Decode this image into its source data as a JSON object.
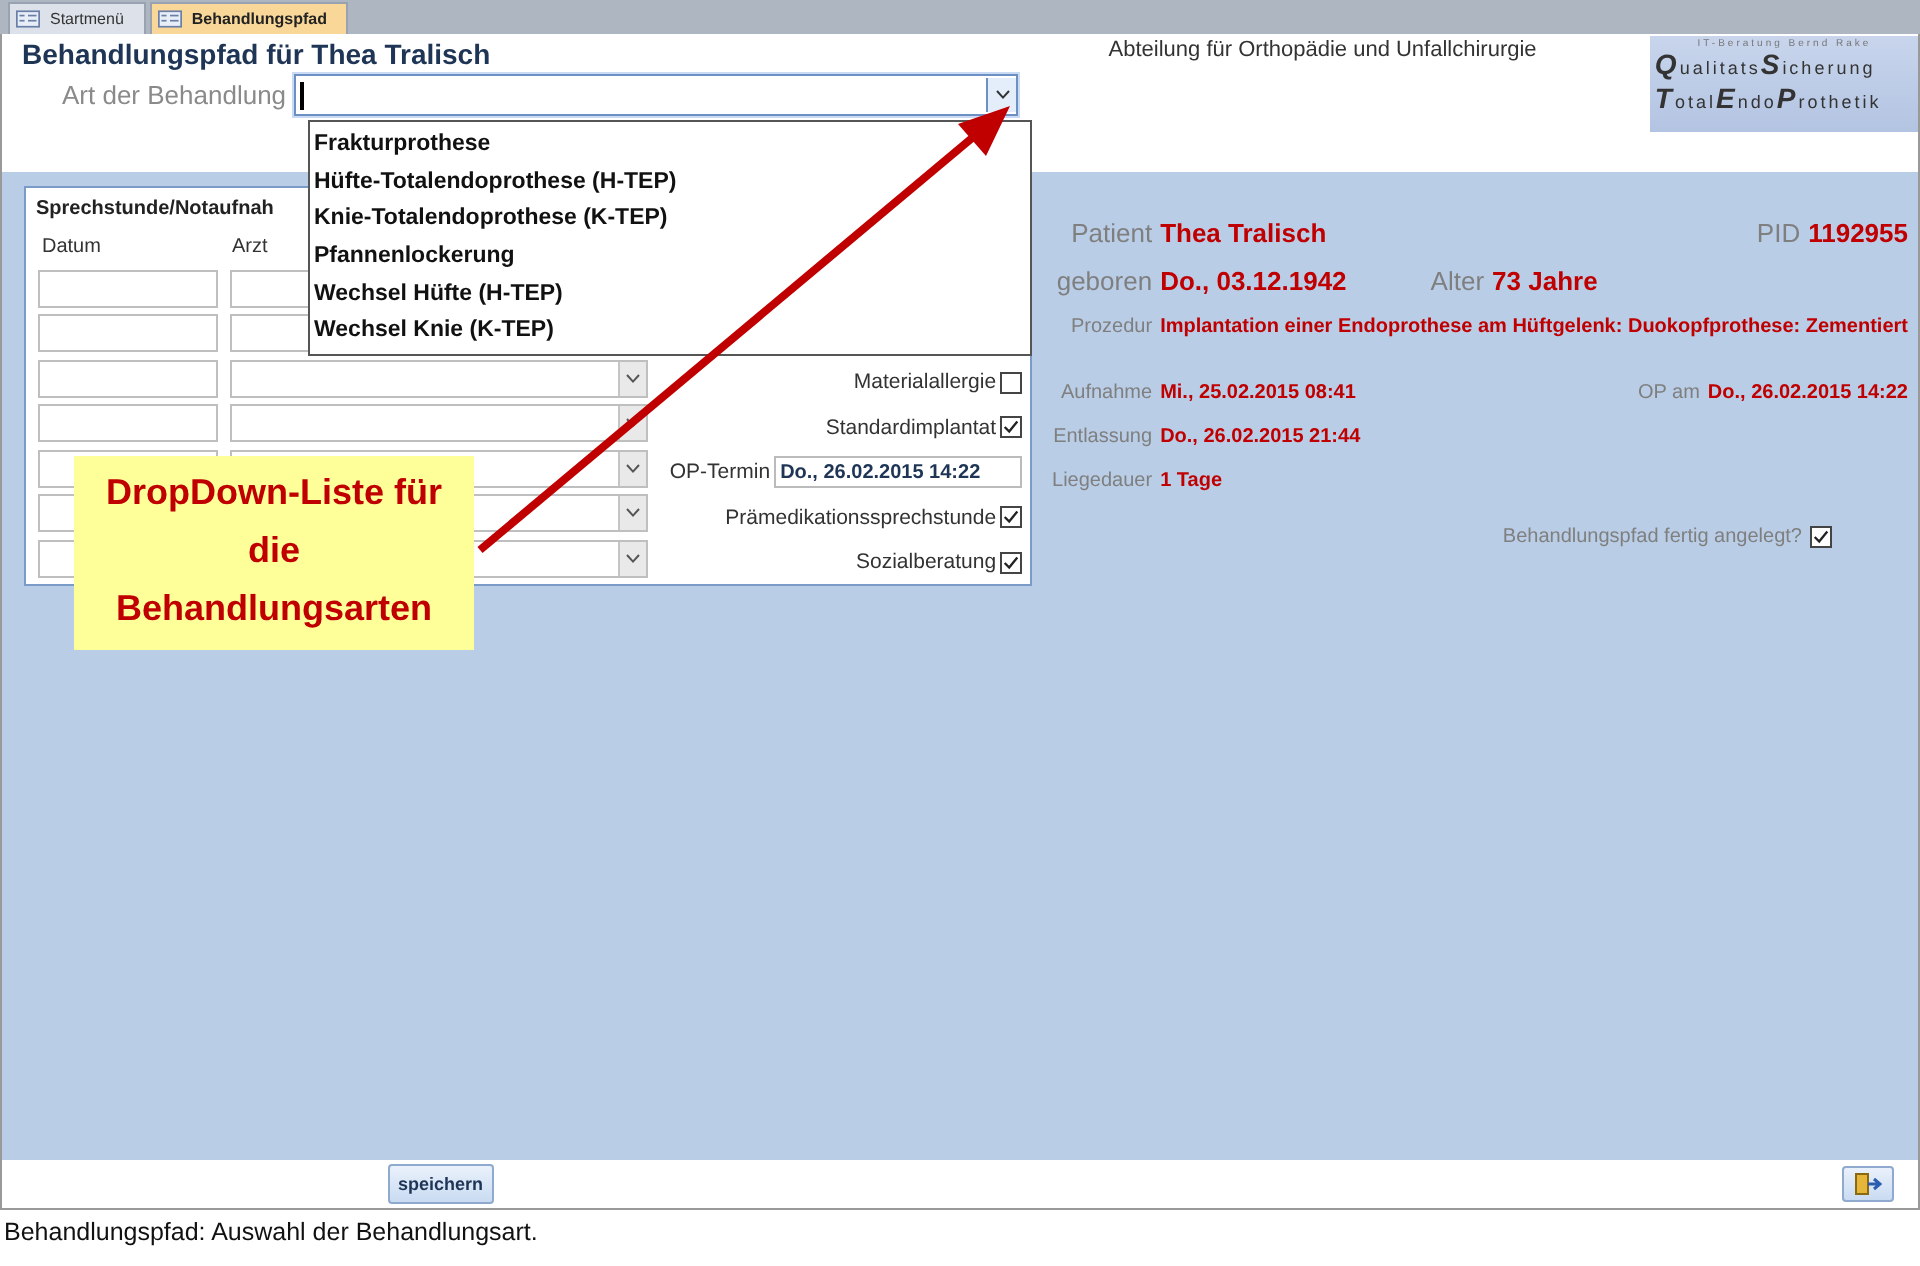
{
  "tabs": [
    {
      "label": "Startmenü",
      "selected": false
    },
    {
      "label": "Behandlungspfad",
      "selected": true
    }
  ],
  "header": {
    "title": "Behandlungspfad für Thea Tralisch",
    "department": "Abteilung für Orthopädie und Unfallchirurgie",
    "logo": {
      "tagline": "IT-Beratung Bernd Rake",
      "line_1": "**Q**ualitats**S**icherung",
      "line_2": "**T**otal**E**ndo**P**rothetik"
    }
  },
  "treatment_combo": {
    "label": "Art der Behandlung",
    "expanded": true,
    "options": [
      "Frakturprothese",
      "Hüfte-Totalendoprothese (H-TEP)",
      "Knie-Totalendoprothese (K-TEP)",
      "Pfannenlockerung",
      "Wechsel Hüfte (H-TEP)",
      "Wechsel Knie (K-TEP)"
    ]
  },
  "consultation": {
    "tab_label": "Sprechstunde/Notaufnah",
    "columns": [
      "Datum",
      "Arzt"
    ],
    "fields": [
      {
        "kind": "checkbox",
        "label": "Materialallergie",
        "checked": false
      },
      {
        "kind": "checkbox",
        "label": "Standardimplantat",
        "checked": true
      },
      {
        "kind": "date",
        "label": "OP-Termin",
        "value": "Do., 26.02.2015 14:22"
      },
      {
        "kind": "checkbox",
        "label": "Prämedikationssprechstunde",
        "checked": true
      },
      {
        "kind": "checkbox",
        "label": "Sozialberatung",
        "checked": true
      }
    ]
  },
  "patient": {
    "name_label": "Patient",
    "name": "Thea Tralisch",
    "pid_label": "PID",
    "pid": "1192955",
    "born_label": "geboren",
    "born": "Do., 03.12.1942",
    "age_label": "Alter",
    "age": "73 Jahre",
    "procedure_label": "Prozedur",
    "procedure": "Implantation einer Endoprothese am Hüftgelenk: Duokopfprothese: Zementiert",
    "admission_label": "Aufnahme",
    "admission": "Mi., 25.02.2015 08:41",
    "op_label": "OP am",
    "op": "Do., 26.02.2015 14:22",
    "discharge_label": "Entlassung",
    "discharge": "Do., 26.02.2015 21:44",
    "stay_label": "Liegedauer",
    "stay": "1 Tage",
    "done_label": "Behandlungspfad fertig angelegt?",
    "done": true
  },
  "callout": "DropDown-Liste für die Behandlungsarten",
  "footer": {
    "save_button": "speichern"
  },
  "caption": "Behandlungspfad: Auswahl der Behandlungsart."
}
